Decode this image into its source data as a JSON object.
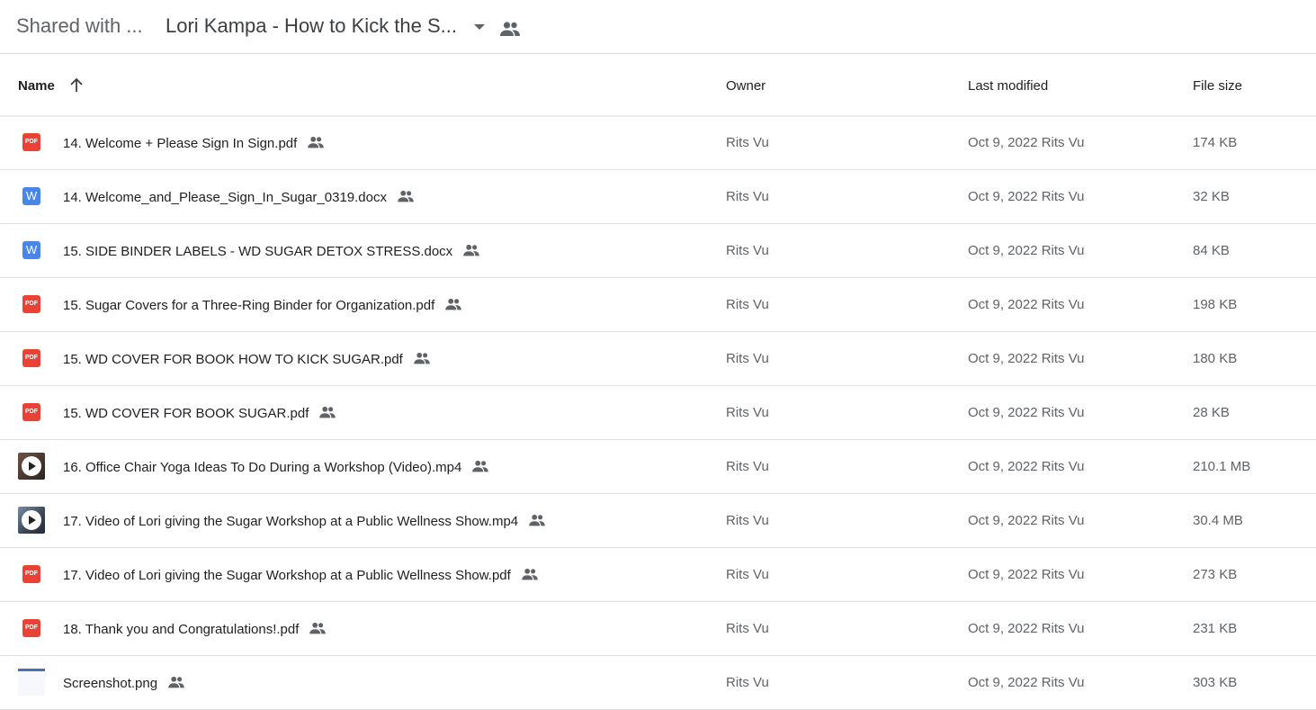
{
  "breadcrumb": {
    "root": "Shared with ...",
    "current": "Lori Kampa - How to Kick the S...",
    "caret_icon": "arrow-drop-down-icon",
    "shared_icon": "people-icon"
  },
  "columns": {
    "name": "Name",
    "sort_icon": "arrow-upward-icon",
    "owner": "Owner",
    "last_modified": "Last modified",
    "file_size": "File size"
  },
  "files": [
    {
      "icon": "pdf",
      "icon_label": "PDF",
      "name": "14. Welcome + Please Sign In Sign.pdf",
      "owner": "Rits Vu",
      "modified": "Oct 9, 2022  Rits Vu",
      "size": "174 KB"
    },
    {
      "icon": "docx",
      "icon_label": "W",
      "name": "14. Welcome_and_Please_Sign_In_Sugar_0319.docx",
      "owner": "Rits Vu",
      "modified": "Oct 9, 2022  Rits Vu",
      "size": "32 KB"
    },
    {
      "icon": "docx",
      "icon_label": "W",
      "name": "15. SIDE BINDER LABELS - WD SUGAR DETOX STRESS.docx",
      "owner": "Rits Vu",
      "modified": "Oct 9, 2022  Rits Vu",
      "size": "84 KB"
    },
    {
      "icon": "pdf",
      "icon_label": "PDF",
      "name": "15. Sugar Covers for a Three-Ring Binder for Organization.pdf",
      "owner": "Rits Vu",
      "modified": "Oct 9, 2022  Rits Vu",
      "size": "198 KB"
    },
    {
      "icon": "pdf",
      "icon_label": "PDF",
      "name": "15. WD COVER FOR BOOK HOW TO KICK SUGAR.pdf",
      "owner": "Rits Vu",
      "modified": "Oct 9, 2022  Rits Vu",
      "size": "180 KB"
    },
    {
      "icon": "pdf",
      "icon_label": "PDF",
      "name": "15. WD COVER FOR BOOK SUGAR.pdf",
      "owner": "Rits Vu",
      "modified": "Oct 9, 2022  Rits Vu",
      "size": "28 KB"
    },
    {
      "icon": "video",
      "icon_label": "",
      "name": "16. Office Chair Yoga Ideas To Do During a Workshop (Video).mp4",
      "owner": "Rits Vu",
      "modified": "Oct 9, 2022  Rits Vu",
      "size": "210.1 MB"
    },
    {
      "icon": "video2",
      "icon_label": "",
      "name": "17. Video of Lori giving the Sugar Workshop at a Public Wellness Show.mp4",
      "owner": "Rits Vu",
      "modified": "Oct 9, 2022  Rits Vu",
      "size": "30.4 MB"
    },
    {
      "icon": "pdf",
      "icon_label": "PDF",
      "name": "17. Video of Lori giving the Sugar Workshop at a Public Wellness Show.pdf",
      "owner": "Rits Vu",
      "modified": "Oct 9, 2022  Rits Vu",
      "size": "273 KB"
    },
    {
      "icon": "pdf",
      "icon_label": "PDF",
      "name": "18. Thank you and Congratulations!.pdf",
      "owner": "Rits Vu",
      "modified": "Oct 9, 2022  Rits Vu",
      "size": "231 KB"
    },
    {
      "icon": "image",
      "icon_label": "",
      "name": "Screenshot.png",
      "owner": "Rits Vu",
      "modified": "Oct 9, 2022  Rits Vu",
      "size": "303 KB"
    }
  ],
  "colors": {
    "pdf_icon": "#ea4335",
    "doc_icon": "#4a86e8",
    "divider": "#dadce0",
    "secondary_text": "#5f6368"
  }
}
